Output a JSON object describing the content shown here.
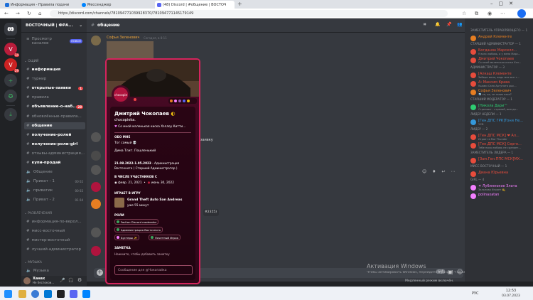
{
  "browser": {
    "tabs": [
      {
        "title": "Информация - Правила подачи",
        "color": "#1e6fd9"
      },
      {
        "title": "Мессенджер",
        "color": "#0084ff"
      },
      {
        "title": "(48) Discord | #общение | ВОСТОЧ",
        "color": "#5865f2"
      }
    ],
    "url": "https://discord.com/channels/781094771039928370/781094771145179149"
  },
  "guild_badges": [
    "34",
    "29"
  ],
  "server": {
    "name": "ВОСТОЧНЫЙ | ФРА...",
    "browse": "Просмотр каналов",
    "new_badge": "НОВОЕ"
  },
  "categories": {
    "info": "ОЩИЙ",
    "fun": "РАЗВЛЕЧЕНИЯ",
    "music": "МУЗЫКА"
  },
  "channels": [
    {
      "name": "информация",
      "type": "text",
      "bright": true
    },
    {
      "name": "турнир",
      "type": "text",
      "bright": false
    },
    {
      "name": "открытые-заявки",
      "type": "text",
      "bright": true,
      "badge": "1"
    },
    {
      "name": "правила",
      "type": "text",
      "bright": false
    },
    {
      "name": "объявление-о-наб...",
      "type": "text",
      "bright": true,
      "badge": "28"
    },
    {
      "name": "обновлённые-правила...",
      "type": "text",
      "bright": false
    },
    {
      "name": "общение",
      "type": "text",
      "bright": true,
      "selected": true
    },
    {
      "name": "получение-ролей",
      "type": "text",
      "bright": true
    },
    {
      "name": "получение-роли-girl",
      "type": "text",
      "bright": true
    },
    {
      "name": "отзывы-администрация...",
      "type": "text",
      "bright": false
    },
    {
      "name": "купи-продай",
      "type": "text",
      "bright": true
    },
    {
      "name": "Общение",
      "type": "voice",
      "bright": false
    },
    {
      "name": "Приват - 1",
      "type": "voice",
      "bright": false,
      "count": "00  02"
    },
    {
      "name": "приватик",
      "type": "voice",
      "bright": false,
      "count": "00  02"
    },
    {
      "name": "Приват - 2",
      "type": "voice",
      "bright": false,
      "count": "01  04"
    }
  ],
  "fun_channels": [
    "информация-по-верол...",
    "мисс-восточный",
    "мистер-восточный",
    "лучший-администратор"
  ],
  "music_channels": [
    "Музыка"
  ],
  "user_panel": {
    "name": "Ханах",
    "status": "Не беспокои..."
  },
  "header": {
    "channel": "общение"
  },
  "chat": {
    "first_author": "Софья Зеленович",
    "first_time": "Сегодня, в 8:11",
    "snippet_right": "заявку",
    "snippet_mid": "#2355)",
    "watermark_title": "Активация Windows",
    "watermark_sub": "Чтобы активировать Windows, перейдите в раздел \"Параметры\".",
    "slowmode": "Медленный режим включён."
  },
  "profile": {
    "name": "Дмитрий Чокопаев",
    "tag": "chocopieka.",
    "custom_status": "Со мной маленькая киска Хэллоу Китти...",
    "about_title": "ОБО МНЕ",
    "about_lines": [
      "Тог самый 💀",
      "Дима  Тлит. Пошленький"
    ],
    "about_date": "21.08.2022-1.05.2023",
    "about_role_a": "- Администрация",
    "about_role_b": "Восточного ( Старший Администратор )",
    "member_since_title": "В ЧИСЛЕ УЧАСТНИКОВ С",
    "member_since_discord": "февр. 21, 2021",
    "member_since_server": "июнь 30, 2022",
    "playing_title": "ИГРАЕТ В ИГРУ",
    "game_name": "Grand Theft Auto San Andreas",
    "game_time": "уже 55 минут",
    "roles_title": "РОЛИ",
    "roles": [
      {
        "name": "Faction Discord moderator",
        "color": "#3ba55d"
      },
      {
        "name": "Администрация Восточного",
        "color": "#3ba55d"
      },
      {
        "name": "Бустеры ✨",
        "color": "#f47fff"
      },
      {
        "name": "Почетный Игрок",
        "color": "#3ba55d"
      }
    ],
    "note_title": "ЗАМЕТКА",
    "note_placeholder": "Нажмите, чтобы добавить заметку",
    "message_placeholder": "Сообщение для @Чокопайка"
  },
  "members": [
    {
      "role": "ЗАМЕСТИТЕЛЬ УПРАВЛЯЮЩЕГО — 1"
    },
    {
      "name": "Андрей Клементе",
      "status": "",
      "color": "#e67e22"
    },
    {
      "role": "СТАРШИЙ АДМИНИСТРАТОР — 1"
    },
    {
      "name": "Богданян Марселл...",
      "status": "У всех любовь, а у меня Марс...",
      "color": "#e74c3c"
    },
    {
      "name": "Дмитрий Чокопаев",
      "status": "Со мной маленькая киска Хэл...",
      "color": "#e74c3c"
    },
    {
      "role": "АДМИНИСТРАТОР — 3"
    },
    {
      "name": "[Алкаш Клементе",
      "status": "Забери меня, ведь мне все т...",
      "color": "#e74c3c"
    },
    {
      "name": "А: Максим Крава",
      "status": "Ушами Саня Артунята рыс...",
      "color": "#e74c3c"
    },
    {
      "name": "Софья Зеленович",
      "status": "💎 ха, ха, че таких взял?",
      "color": "#e67e22"
    },
    {
      "role": "СТАРШИЙ МОДЕРАТОР — 1"
    },
    {
      "name": "[Никола Дари™",
      "status": "Стреляют - стреляй, всегда...",
      "color": "#2ecc71"
    },
    {
      "role": "ЛИДЕР НЕДЕЛИ — 1"
    },
    {
      "name": "[Ген.ДПС ГРК]Тони Не...",
      "status": "ЧСВ",
      "color": "#3498db"
    },
    {
      "role": "ЛИДЕР — 2"
    },
    {
      "name": "[Ген.ДПС МСК] ❤ Ал...",
      "status": "Играет в Mar Thunder",
      "color": "#e74c3c"
    },
    {
      "name": "[Ген.ДПС МСК] Серге...",
      "status": "Тебе пока любовь не сделает...",
      "color": "#e74c3c"
    },
    {
      "role": "ЗАМЕСТИТЕЛЬ ЛИДЕРА — 1"
    },
    {
      "name": "[Зам.Ген.ППС МСК]МХ...",
      "status": "",
      "color": "#e74c3c"
    },
    {
      "role": "МИСС ВОСТОЧНЫЙ — 1"
    },
    {
      "name": "Диана Юрьевна",
      "status": "",
      "color": "#e74c3c"
    },
    {
      "role": "GIRL — 4"
    },
    {
      "name": "✦ Лубиннокое Злата",
      "status": "Зальнова Играет 💫",
      "color": "#f47fff"
    },
    {
      "name": "polinaxatan",
      "status": "",
      "color": "#f47fff"
    }
  ],
  "taskbar": {
    "lang": "РУС",
    "time": "12:53",
    "date": "03.07.2023"
  },
  "colors": {
    "blurple": "#5865f2",
    "popup_border": "#d6245e",
    "danger": "#ed4245"
  },
  "icons": [
    "discord-icon",
    "plus-icon",
    "compass-icon",
    "download-icon",
    "hash-icon",
    "speaker-icon",
    "mic-icon",
    "headphones-icon",
    "gear-icon",
    "search-icon",
    "bell-icon",
    "pin-icon",
    "members-icon",
    "inbox-icon",
    "help-icon"
  ]
}
